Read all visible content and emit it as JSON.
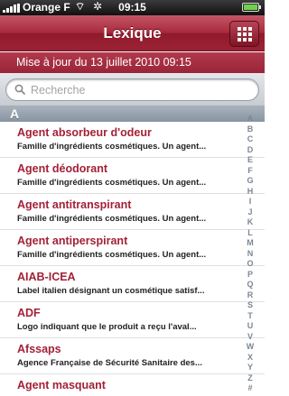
{
  "status_bar": {
    "carrier": "Orange F",
    "time": "09:15",
    "wifi_icon": "wifi-icon",
    "activity_icon": "activity-icon",
    "battery_level": 1.0
  },
  "nav": {
    "title": "Lexique",
    "menu_icon": "grid-icon"
  },
  "update_banner": "Mise à jour du 13 juillet 2010 09:15",
  "search": {
    "placeholder": "Recherche",
    "value": ""
  },
  "section": "A",
  "items": [
    {
      "title": "Agent absorbeur d'odeur",
      "desc": "Famille d'ingrédients cosmétiques. Un agent..."
    },
    {
      "title": "Agent déodorant",
      "desc": "Famille d'ingrédients cosmétiques. Un agent..."
    },
    {
      "title": "Agent antitranspirant",
      "desc": "Famille d'ingrédients cosmétiques. Un agent..."
    },
    {
      "title": "Agent antiperspirant",
      "desc": "Famille d'ingrédients cosmétiques. Un agent..."
    },
    {
      "title": "AIAB-ICEA",
      "desc": "Label italien désignant un cosmétique satisf..."
    },
    {
      "title": "ADF",
      "desc": "Logo indiquant que le produit a reçu l'aval..."
    },
    {
      "title": "Afssaps",
      "desc": "Agence Française de Sécurité Sanitaire des..."
    },
    {
      "title": "Agent masquant",
      "desc": ""
    }
  ],
  "index_letters": [
    "A",
    "B",
    "C",
    "D",
    "E",
    "F",
    "G",
    "H",
    "I",
    "J",
    "K",
    "L",
    "M",
    "N",
    "O",
    "P",
    "Q",
    "R",
    "S",
    "T",
    "U",
    "V",
    "W",
    "X",
    "Y",
    "Z",
    "#"
  ],
  "colors": {
    "accent": "#a32138",
    "nav_bar": "#9c2234",
    "section_header": "#8f9aa8"
  }
}
